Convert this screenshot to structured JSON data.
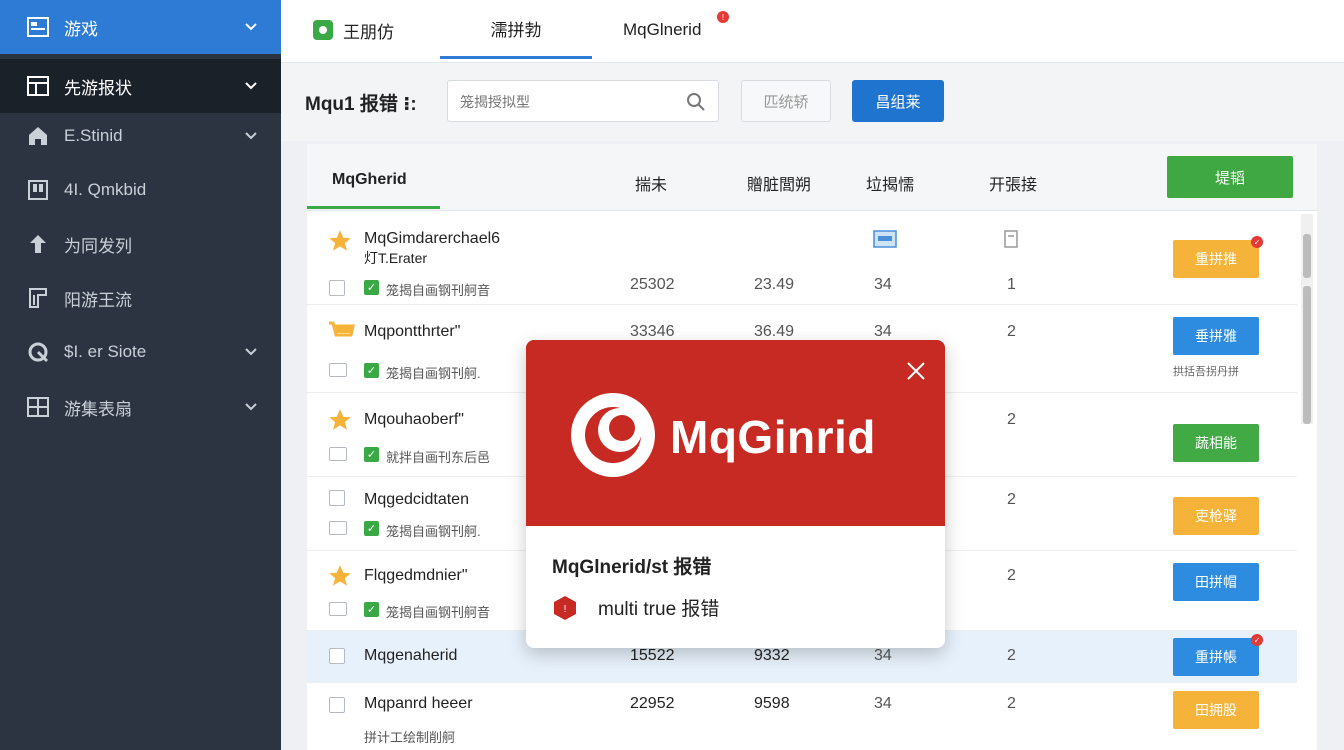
{
  "sidebar": {
    "items": [
      {
        "label": "游戏",
        "icon": "window-icon"
      },
      {
        "label": "先游报状",
        "icon": "layout-icon"
      },
      {
        "label": "E.Stinid",
        "icon": "home-icon"
      },
      {
        "label": "4I. Qmkbid",
        "icon": "gamepad-icon"
      },
      {
        "label": "为同发列",
        "icon": "upload-icon"
      },
      {
        "label": "阳游王流",
        "icon": "chart-icon"
      },
      {
        "label": "$I. er Siote",
        "icon": "shield-icon"
      },
      {
        "label": "游集表扇",
        "icon": "grid-icon"
      }
    ]
  },
  "tabs": [
    {
      "label": "王朋仿"
    },
    {
      "label": "濡拼勃"
    },
    {
      "label": "MqGlnerid"
    }
  ],
  "search": {
    "label": "Mqu1 报错 ⁝:",
    "placeholder": "笼揭授拟型",
    "reset_label": "匹统轿",
    "query_label": "昌组莱"
  },
  "table": {
    "headers": [
      "MqGherid",
      "揣未",
      "贈脏閭朔",
      "垃揭懦",
      "开張接"
    ],
    "add_label": "堤韬",
    "rows": [
      {
        "name": "MqGimdarerchael6",
        "name2": "灯T.Erater",
        "sub": "笼揭自画钢刊舸音",
        "v1": "25302",
        "v2": "23.49",
        "v3": "34",
        "v4": "1",
        "action": "重拼推",
        "note": ""
      },
      {
        "name": "Mqpontthrter\"",
        "sub": "笼揭自画钢刊舸.",
        "v1": "33346",
        "v2": "36.49",
        "v3": "34",
        "v4": "2",
        "action": "垂拼雅",
        "note": "拱括吾拐丹拼"
      },
      {
        "name": "Mqouhaoberf\"",
        "sub": "就拌自画刊东后邑",
        "v1": "",
        "v2": "",
        "v3": "",
        "v4": "2",
        "action": "蔬相能",
        "note": ""
      },
      {
        "name": "Mqgedcidtaten",
        "sub": "笼揭自画钢刊舸.",
        "v1": "",
        "v2": "",
        "v3": "",
        "v4": "2",
        "action": "吏枪驿",
        "note": ""
      },
      {
        "name": "Flqgedmdnier\"",
        "sub": "笼揭自画钢刊舸音",
        "v1": "",
        "v2": "",
        "v3": "",
        "v4": "2",
        "action": "田拼帽",
        "note": ""
      },
      {
        "name": "Mqgenaherid",
        "sub": "",
        "v1": "15522",
        "v2": "9332",
        "v3": "34",
        "v4": "2",
        "action": "重拼帳",
        "note": ""
      },
      {
        "name": "Mqpanrd heeer",
        "sub": "拼计工绘制削舸",
        "v1": "22952",
        "v2": "9598",
        "v3": "34",
        "v4": "2",
        "action": "田拥股",
        "note": ""
      }
    ]
  },
  "popup": {
    "brand": "MqGinrid",
    "title": "MqGlnerid/st 报错",
    "message": "multi true 报错"
  },
  "colors": {
    "sidebar_bg": "#2b3440",
    "sidebar_active": "#2e7bd6",
    "primary": "#1f74cf",
    "success": "#3fa842",
    "warning": "#f5b33a",
    "popup_red": "#c62a22"
  }
}
